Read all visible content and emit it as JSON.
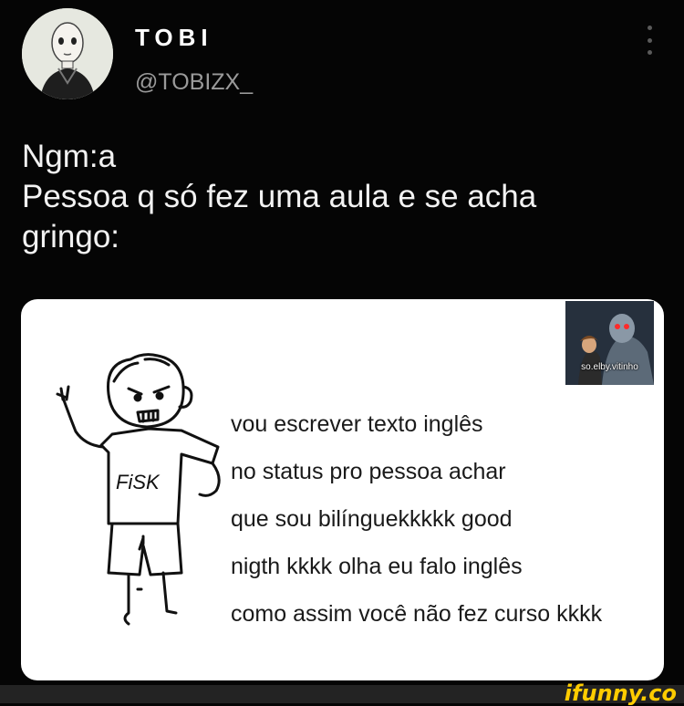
{
  "profile": {
    "display_name": "TOBI",
    "handle": "@TOBIZX_"
  },
  "tweet": {
    "lines": [
      "Ngm:a",
      "Pessoa q só fez uma aula e se acha",
      "gringo:"
    ]
  },
  "meme": {
    "shirt_text": "FiSK",
    "text_lines": [
      "vou escrever texto inglês",
      "no status pro pessoa achar",
      "que sou bilínguekkkkk good",
      "nigth kkkk olha eu falo inglês",
      "como assim você não fez curso kkkk"
    ]
  },
  "watermark": {
    "label": "so.elby.vitinho"
  },
  "site": {
    "logo": "ifunny.co"
  },
  "icons": {
    "menu": "more-vertical-icon"
  },
  "colors": {
    "background": "#050505",
    "handle": "#9a9a9a",
    "card": "#ffffff",
    "logo": "#ffcc00"
  }
}
